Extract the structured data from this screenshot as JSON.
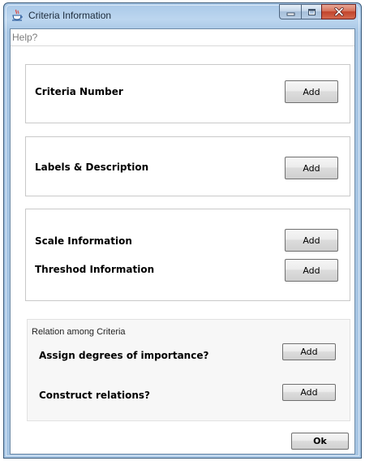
{
  "window": {
    "title": "Criteria Information",
    "icon": "java-cup-icon",
    "caption_buttons": [
      "minimize",
      "maximize",
      "close"
    ]
  },
  "menu": {
    "items": [
      {
        "label": "Help?"
      }
    ]
  },
  "panels": {
    "criteria_number": {
      "label": "Criteria Number",
      "button": "Add"
    },
    "labels_description": {
      "label": "Labels & Description",
      "button": "Add"
    },
    "scale_threshold": {
      "rows": [
        {
          "label": "Scale Information",
          "button": "Add"
        },
        {
          "label": "Threshod Information",
          "button": "Add"
        }
      ]
    }
  },
  "relation_group": {
    "title": "Relation among Criteria",
    "rows": [
      {
        "label": "Assign degrees of importance?",
        "button": "Add"
      },
      {
        "label": "Construct relations?",
        "button": "Add"
      }
    ]
  },
  "footer": {
    "ok_label": "Ok"
  },
  "colors": {
    "titlebar": "#a9c8e8",
    "close_button": "#c2432b",
    "panel_border": "#c9c9c9"
  }
}
